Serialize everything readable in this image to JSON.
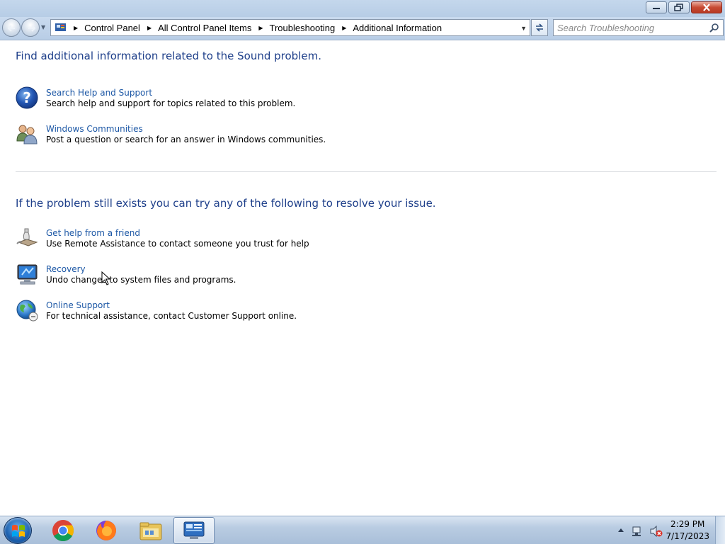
{
  "window": {
    "title": "",
    "caption_buttons": [
      "minimize",
      "restore",
      "close"
    ]
  },
  "navigation": {
    "breadcrumbs": [
      "Control Panel",
      "All Control Panel Items",
      "Troubleshooting",
      "Additional Information"
    ],
    "search_placeholder": "Search Troubleshooting"
  },
  "content": {
    "heading_1": "Find additional information related to the Sound problem.",
    "section_1_items": [
      {
        "icon": "help-icon",
        "link": "Search Help and Support",
        "description": "Search help and support for topics related to this problem."
      },
      {
        "icon": "communities-icon",
        "link": "Windows Communities",
        "description": "Post a question or search for an answer in Windows communities."
      }
    ],
    "heading_2": "If the problem still exists you can try any of the following to resolve your issue.",
    "section_2_items": [
      {
        "icon": "remote-assistance-icon",
        "link": "Get help from a friend",
        "description": "Use Remote Assistance to contact someone you trust for help"
      },
      {
        "icon": "recovery-icon",
        "link": "Recovery",
        "description": "Undo changes to system files and programs."
      },
      {
        "icon": "globe-icon",
        "link": "Online Support",
        "description": "For technical assistance, contact Customer Support online."
      }
    ]
  },
  "taskbar": {
    "pinned": [
      "chrome-icon",
      "firefox-icon",
      "explorer-icon",
      "control-panel-icon"
    ],
    "active": "control-panel-icon",
    "clock_time": "2:29 PM",
    "clock_date": "7/17/2023",
    "tray_icons": [
      "show-hidden-icons",
      "network-icon",
      "volume-muted-icon"
    ]
  },
  "colors": {
    "link": "#1c57a5",
    "heading": "#1e3f8a",
    "titlebar": "#b7cde6"
  }
}
